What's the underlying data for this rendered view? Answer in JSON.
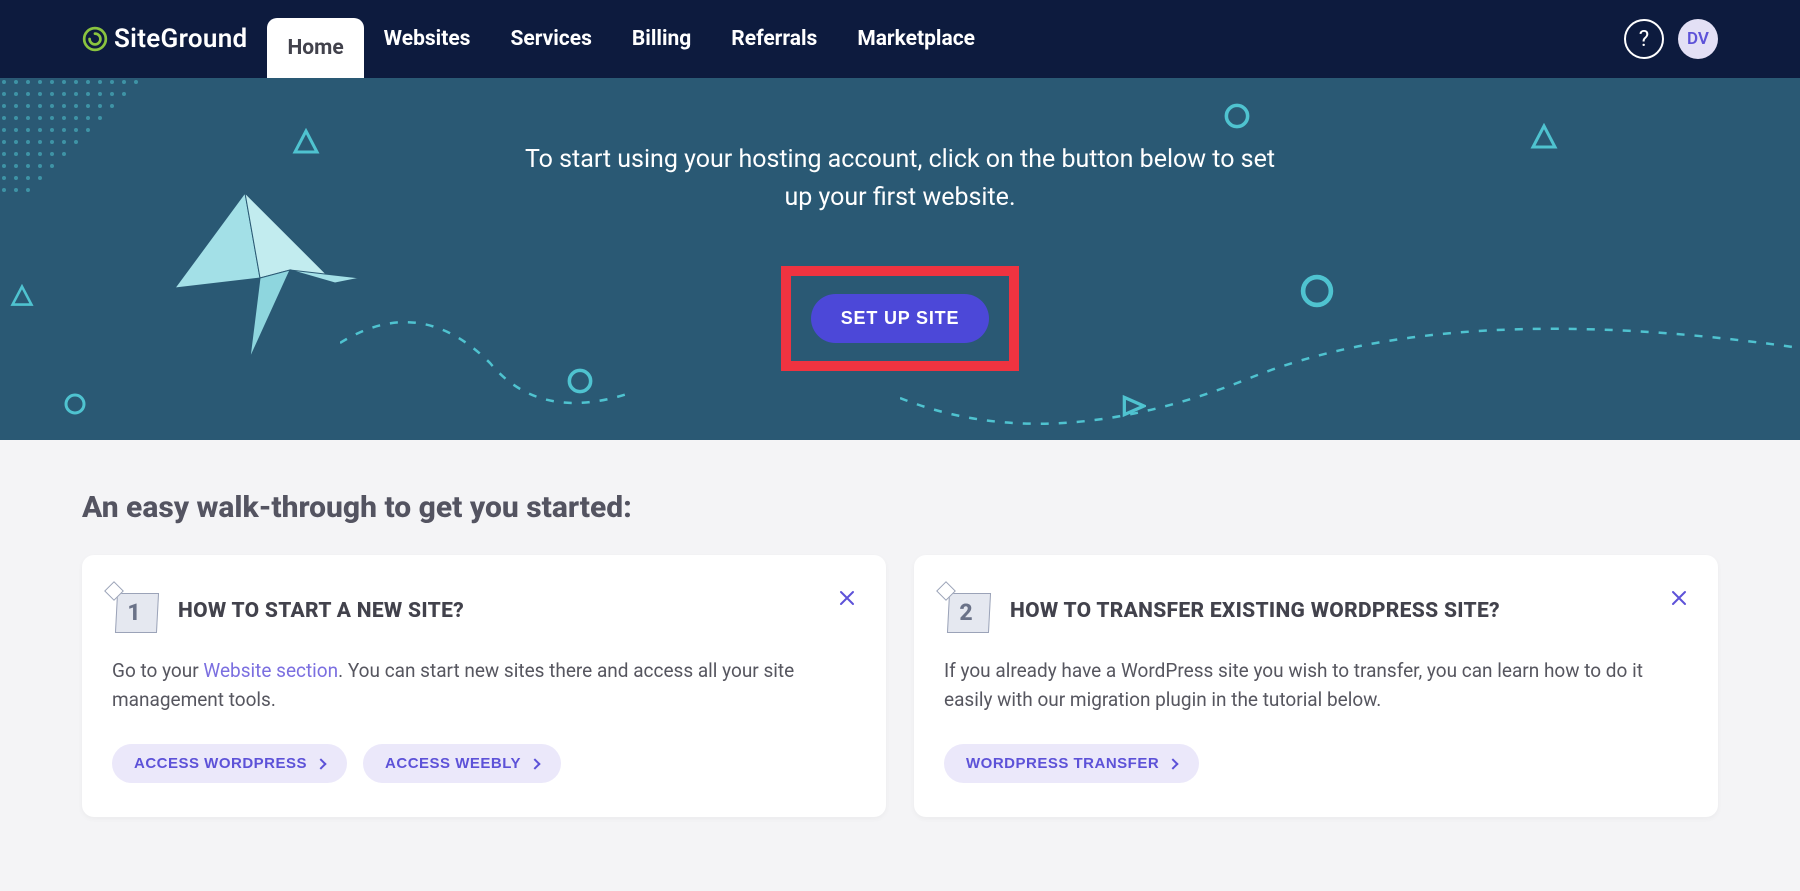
{
  "brand_name": "SiteGround",
  "nav": [
    {
      "label": "Home"
    },
    {
      "label": "Websites"
    },
    {
      "label": "Services"
    },
    {
      "label": "Billing"
    },
    {
      "label": "Referrals"
    },
    {
      "label": "Marketplace"
    }
  ],
  "user_initials": "DV",
  "hero": {
    "text": "To start using your hosting account, click on the button below to set up your first website.",
    "cta": "SET UP SITE"
  },
  "section_title": "An easy walk-through to get you started:",
  "cards": [
    {
      "number": "1",
      "title": "HOW TO START A NEW SITE?",
      "desc_pre": "Go to your ",
      "link_text": "Website section",
      "desc_post": ". You can start new sites there and access all your site management tools.",
      "actions": [
        {
          "label": "ACCESS WORDPRESS"
        },
        {
          "label": "ACCESS WEEBLY"
        }
      ]
    },
    {
      "number": "2",
      "title": "HOW TO TRANSFER EXISTING WORDPRESS SITE?",
      "desc_full": "If you already have a WordPress site you wish to transfer, you can learn how to do it easily with our migration plugin in the tutorial below.",
      "actions": [
        {
          "label": "WORDPRESS TRANSFER"
        }
      ]
    }
  ]
}
